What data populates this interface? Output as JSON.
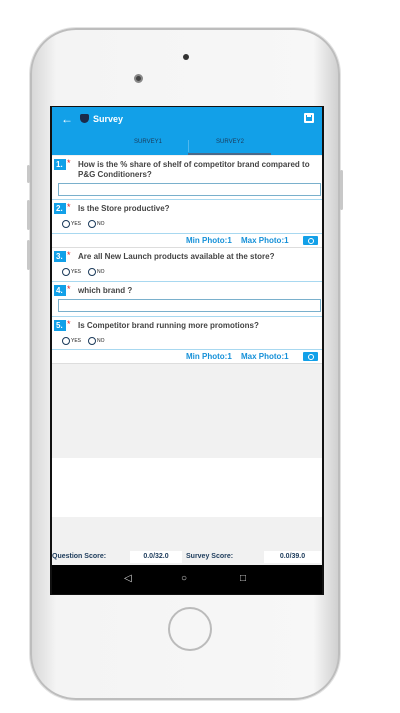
{
  "header": {
    "title": "Survey",
    "back_icon": "arrow-left-icon",
    "save_icon": "save-icon",
    "color": "#12a0e8"
  },
  "tabs": [
    {
      "label": "SURVEY1"
    },
    {
      "label": "SURVEY2",
      "active": true
    }
  ],
  "questions": [
    {
      "number": "1.",
      "required": "*",
      "text": "How is the % share of shelf of competitor brand compared to P&G Conditioners?",
      "type": "text",
      "value": ""
    },
    {
      "number": "2.",
      "required": "*",
      "text": "Is the Store productive?",
      "type": "radio",
      "options": [
        "YES",
        "NO"
      ]
    },
    {
      "number": "3.",
      "required": "*",
      "text": "Are all New Launch products available at the store?",
      "type": "radio",
      "options": [
        "YES",
        "NO"
      ]
    },
    {
      "number": "4.",
      "required": "*",
      "text": "which brand ?",
      "type": "text",
      "value": ""
    },
    {
      "number": "5.",
      "required": "*",
      "text": "Is Competitor brand running more promotions?",
      "type": "radio",
      "options": [
        "YES",
        "NO"
      ]
    }
  ],
  "photo": {
    "min": "Min Photo:1",
    "max": "Max Photo:1",
    "icon": "camera-icon"
  },
  "scores": {
    "question_label": "Question Score:",
    "question_value": "0.0/32.0",
    "survey_label": "Survey Score:",
    "survey_value": "0.0/39.0"
  },
  "navbar": {
    "back": "◁",
    "home": "○",
    "recent": "□"
  }
}
